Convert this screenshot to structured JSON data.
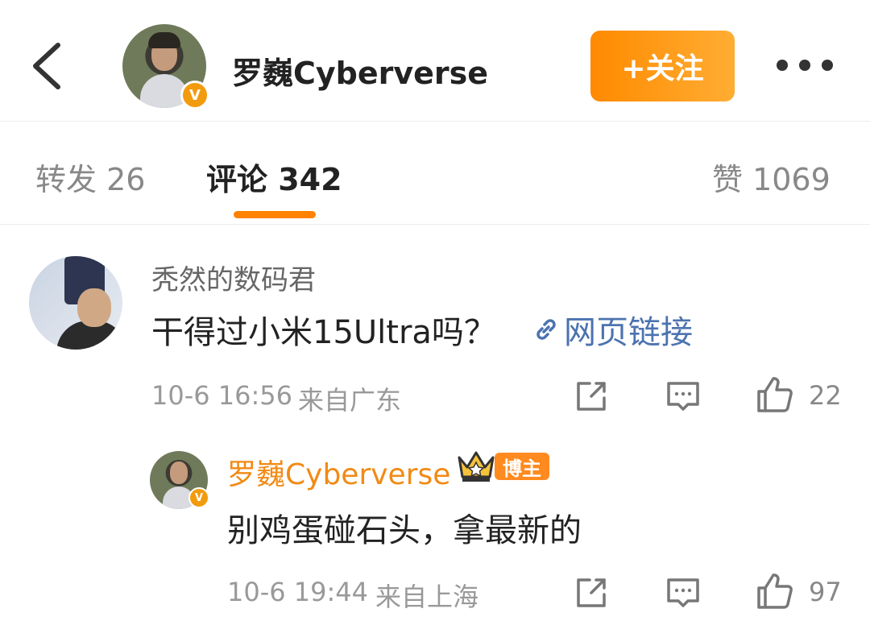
{
  "header": {
    "username": "罗巍Cyberverse",
    "follow_label": "+关注",
    "verified_badge": "V"
  },
  "tabs": {
    "repost": "转发 26",
    "comment": "评论 342",
    "like": "赞 1069"
  },
  "comment": {
    "author": "秃然的数码君",
    "text": "干得过小米15Ultra吗？",
    "link_label": "网页链接",
    "time": "10-6 16:56",
    "location": "来自广东",
    "likes": "22"
  },
  "reply": {
    "author": "罗巍Cyberverse",
    "role_badge": "博主",
    "text": "别鸡蛋碰石头，拿最新的",
    "time": "10-6 19:44",
    "location": "来自上海",
    "likes": "97"
  },
  "colors": {
    "accent": "#ff8200",
    "follow_gradient": [
      "#ff8a00",
      "#ffad33"
    ],
    "link": "#4c73b0",
    "author_reply": "#f28a14"
  },
  "icons": [
    "back-icon",
    "more-icon",
    "link-icon",
    "share-icon",
    "comment-icon",
    "thumb-up-icon",
    "crown-icon"
  ]
}
